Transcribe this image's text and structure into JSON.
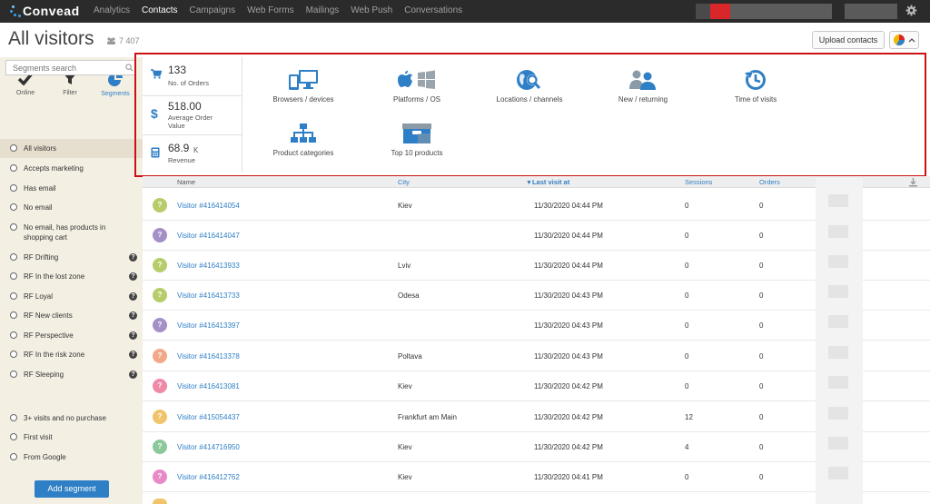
{
  "app": {
    "brand": "Convead"
  },
  "nav": [
    {
      "label": "Analytics",
      "active": false
    },
    {
      "label": "Contacts",
      "active": true
    },
    {
      "label": "Campaigns",
      "active": false
    },
    {
      "label": "Web Forms",
      "active": false
    },
    {
      "label": "Mailings",
      "active": false
    },
    {
      "label": "Web Push",
      "active": false
    },
    {
      "label": "Conversations",
      "active": false
    }
  ],
  "header": {
    "title": "All visitors",
    "count": "7 407",
    "upload_label": "Upload contacts"
  },
  "sidebar": {
    "tools": [
      {
        "label": "Online",
        "icon": "check-icon"
      },
      {
        "label": "Filter",
        "icon": "filter-icon"
      },
      {
        "label": "Segments",
        "icon": "pie-icon"
      }
    ],
    "search_placeholder": "Segments search",
    "segments": [
      {
        "label": "All visitors",
        "help": false,
        "selected": true
      },
      {
        "label": "Accepts marketing",
        "help": false
      },
      {
        "label": "Has email",
        "help": false
      },
      {
        "label": "No email",
        "help": false
      },
      {
        "label": "No email, has products in shopping cart",
        "help": false
      },
      {
        "label": "RF Drifting",
        "help": true
      },
      {
        "label": "RF In the lost zone",
        "help": true
      },
      {
        "label": "RF Loyal",
        "help": true
      },
      {
        "label": "RF New clients",
        "help": true
      },
      {
        "label": "RF Perspective",
        "help": true
      },
      {
        "label": "RF In the risk zone",
        "help": true
      },
      {
        "label": "RF Sleeping",
        "help": true
      },
      {
        "label": "3+ visits and no purchase",
        "help": false
      },
      {
        "label": "First visit",
        "help": false
      },
      {
        "label": "From Google",
        "help": false
      }
    ],
    "add_label": "Add segment"
  },
  "stats": [
    {
      "value": "133",
      "label": "No. of Orders",
      "icon": "cart-icon"
    },
    {
      "value": "518.00",
      "label1": "Average Order",
      "label2": "Value",
      "icon": "dollar-icon"
    },
    {
      "value": "68.9",
      "suffix": "K",
      "label": "Revenue",
      "icon": "calculator-icon"
    }
  ],
  "reports": [
    {
      "label": "Browsers / devices",
      "icon": "devices-icon"
    },
    {
      "label": "Platforms / OS",
      "icon": "platforms-icon"
    },
    {
      "label": "Locations / channels",
      "icon": "location-icon"
    },
    {
      "label": "New / returning",
      "icon": "users-icon"
    },
    {
      "label": "Time of visits",
      "icon": "clock-icon"
    },
    {
      "label": "Product categories",
      "icon": "sitemap-icon"
    },
    {
      "label": "Top 10 products",
      "icon": "products-icon"
    }
  ],
  "table": {
    "columns": {
      "name": "Name",
      "city": "City",
      "last_visit": "Last visit at",
      "sessions": "Sessions",
      "orders": "Orders"
    },
    "rows": [
      {
        "name": "Visitor #416414054",
        "city": "Kiev",
        "last": "11/30/2020 04:44 PM",
        "sessions": "0",
        "orders": "0",
        "color": "#b7cc6a"
      },
      {
        "name": "Visitor #416414047",
        "city": "",
        "last": "11/30/2020 04:44 PM",
        "sessions": "0",
        "orders": "0",
        "color": "#a58fc7"
      },
      {
        "name": "Visitor #416413933",
        "city": "Lviv",
        "last": "11/30/2020 04:44 PM",
        "sessions": "0",
        "orders": "0",
        "color": "#b7cc6a"
      },
      {
        "name": "Visitor #416413733",
        "city": "Odesa",
        "last": "11/30/2020 04:43 PM",
        "sessions": "0",
        "orders": "0",
        "color": "#b7cc6a"
      },
      {
        "name": "Visitor #416413397",
        "city": "",
        "last": "11/30/2020 04:43 PM",
        "sessions": "0",
        "orders": "0",
        "color": "#a58fc7"
      },
      {
        "name": "Visitor #416413378",
        "city": "Poltava",
        "last": "11/30/2020 04:43 PM",
        "sessions": "0",
        "orders": "0",
        "color": "#f1a98a"
      },
      {
        "name": "Visitor #416413081",
        "city": "Kiev",
        "last": "11/30/2020 04:42 PM",
        "sessions": "0",
        "orders": "0",
        "color": "#ef8aa8"
      },
      {
        "name": "Visitor #415054437",
        "city": "Frankfurt am Main",
        "last": "11/30/2020 04:42 PM",
        "sessions": "12",
        "orders": "0",
        "color": "#f0c46a"
      },
      {
        "name": "Visitor #414716950",
        "city": "Kiev",
        "last": "11/30/2020 04:42 PM",
        "sessions": "4",
        "orders": "0",
        "color": "#8cc89a"
      },
      {
        "name": "Visitor #416412762",
        "city": "Kiev",
        "last": "11/30/2020 04:41 PM",
        "sessions": "0",
        "orders": "0",
        "color": "#e98ac8"
      }
    ]
  },
  "colors": {
    "accent": "#2f7fc6",
    "highlight_border": "#cc1111",
    "topbar": "#2b2b2b",
    "sidebar": "#f4efe3"
  }
}
